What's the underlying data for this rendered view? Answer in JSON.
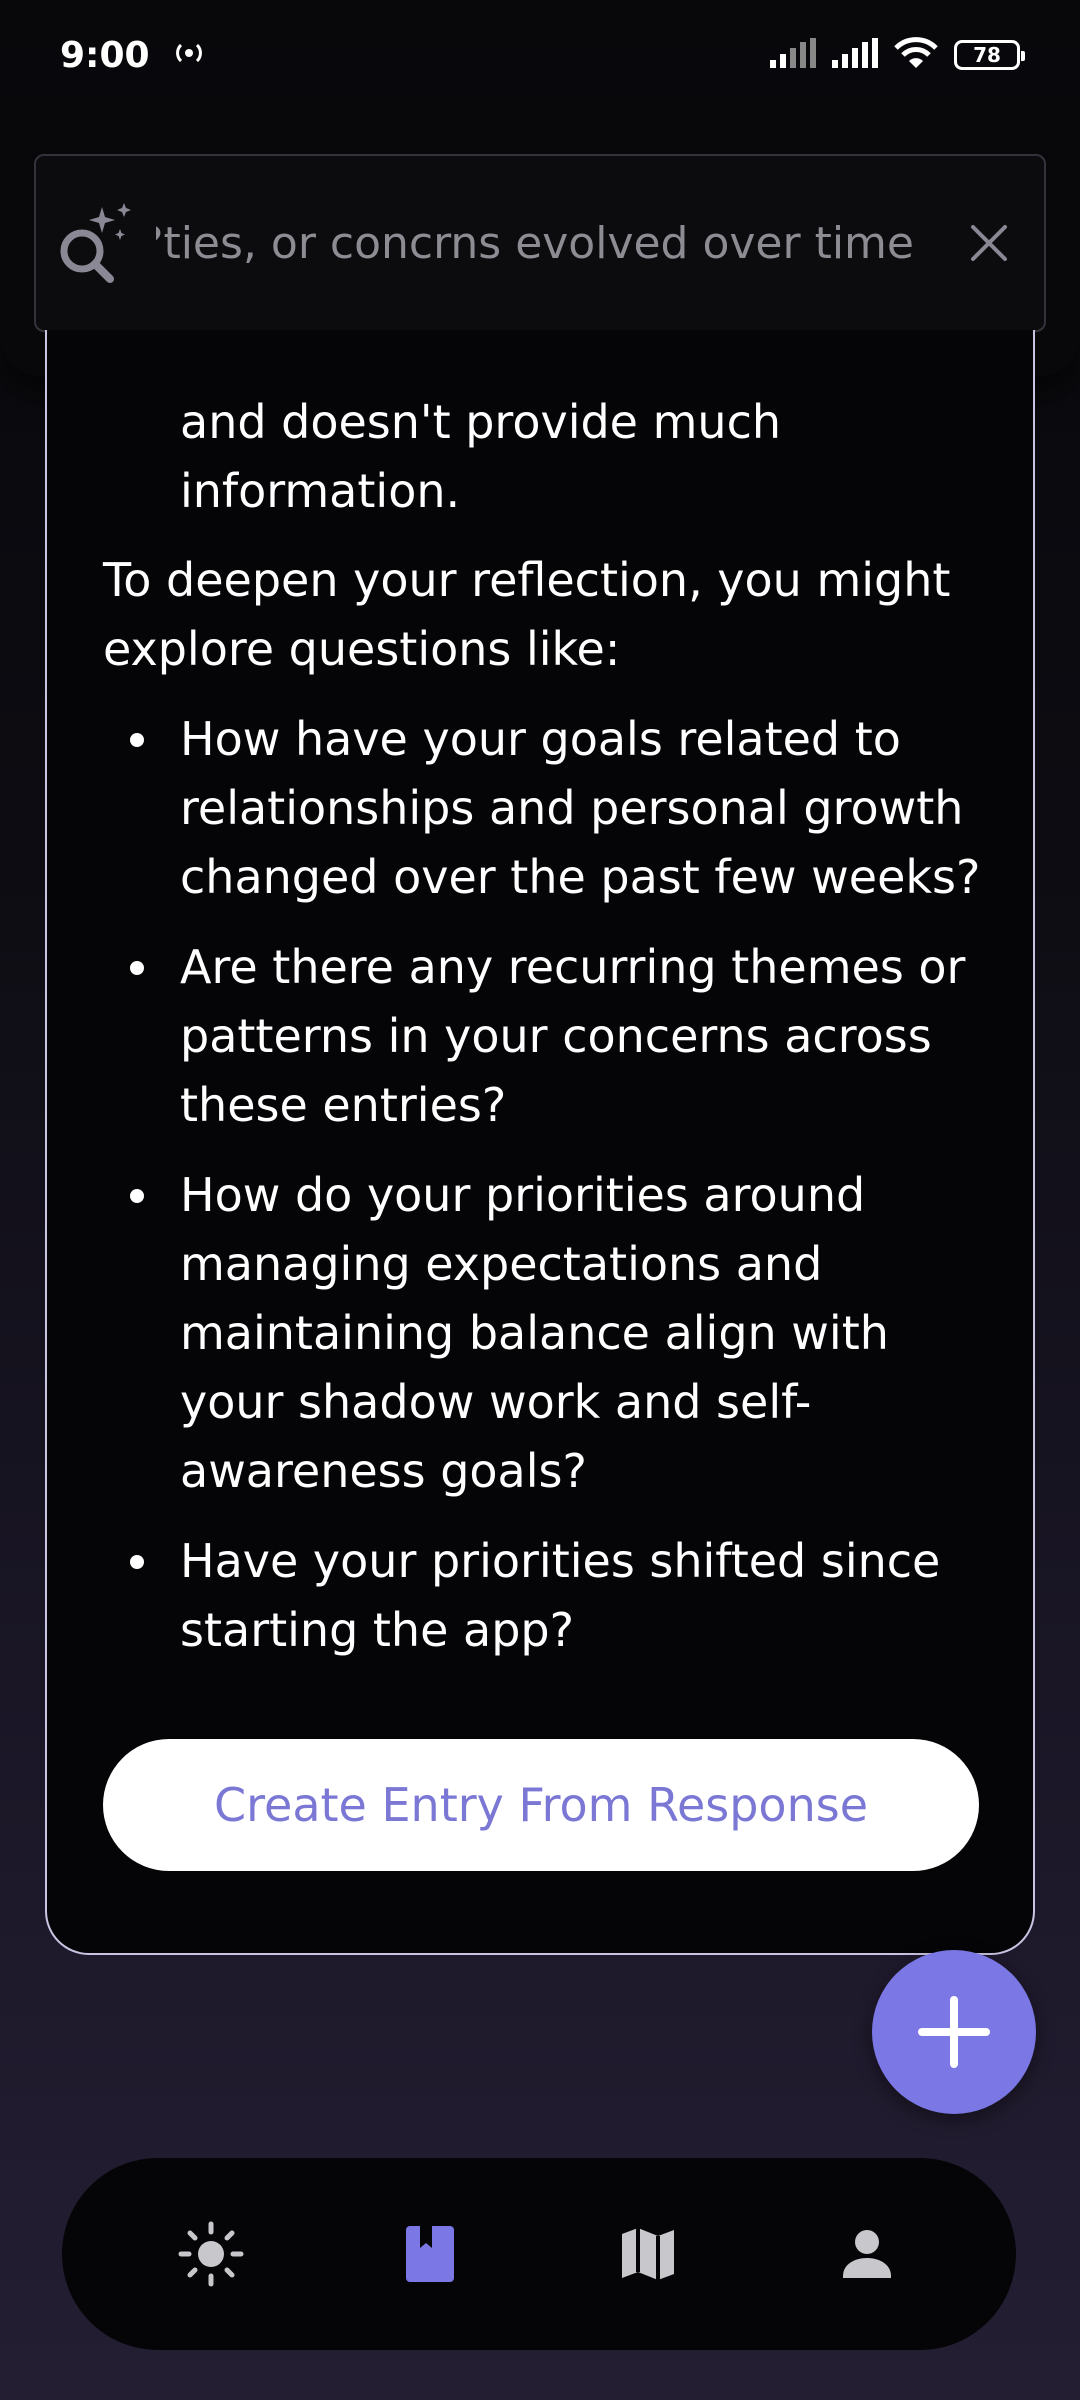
{
  "status_bar": {
    "time": "9:00",
    "battery": "78"
  },
  "search": {
    "query": "ties, or concrns evolved over time?",
    "icon": "search-sparkle-icon",
    "clear_icon": "close-icon"
  },
  "response": {
    "continued_text": "and doesn't provide much information.",
    "intro": "To deepen your reflection, you might explore questions like:",
    "questions": [
      "How have your goals related to relationships and personal growth changed over the past few weeks?",
      "Are there any recurring themes or patterns in your concerns across these entries?",
      "How do your priorities around managing expectations and maintaining balance align with your shadow work and self-awareness goals?",
      "Have your priorities shifted since starting the app?"
    ],
    "action_label": "Create Entry From Response"
  },
  "fab": {
    "icon": "plus-icon"
  },
  "nav": {
    "items": [
      {
        "icon": "sun-icon",
        "active": false
      },
      {
        "icon": "journal-icon",
        "active": true
      },
      {
        "icon": "map-icon",
        "active": false
      },
      {
        "icon": "profile-icon",
        "active": false
      }
    ]
  },
  "colors": {
    "accent": "#7b78e6",
    "button_text": "#7b77d4",
    "card_border": "#c9c4e2",
    "nav_inactive": "#c8c8cc"
  }
}
